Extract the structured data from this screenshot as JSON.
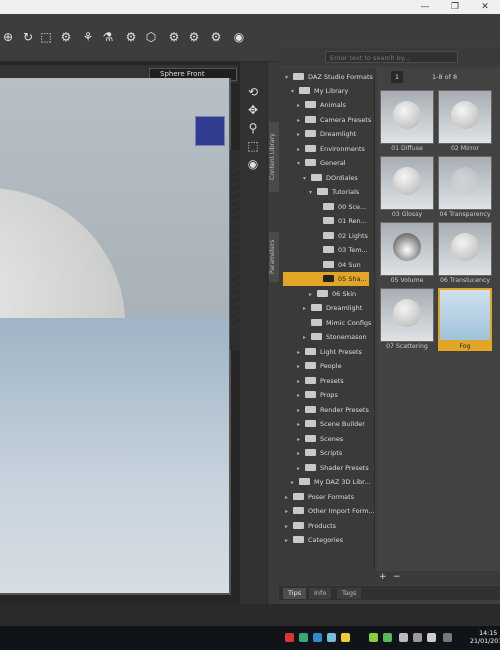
{
  "window": {
    "minimize_glyph": "—",
    "restore_glyph": "❐",
    "close_glyph": "✕"
  },
  "toolbar": {
    "icons": [
      "⊕",
      "↻",
      "⬚",
      "⚙",
      "⚘",
      "⚗",
      "⚙",
      "⬡",
      "⚙",
      "⚙",
      "⚙",
      "◉"
    ]
  },
  "viewport": {
    "camera": "Sphere Front"
  },
  "content_library": {
    "tab_label": "Content Library",
    "side_tabs": [
      "Content Library",
      "Parameters"
    ],
    "search_placeholder": "Enter text to search by...",
    "tree": [
      {
        "label": "DAZ Studio Formats",
        "level": 0
      },
      {
        "label": "My Library",
        "level": 1
      },
      {
        "label": "Animals",
        "level": 2
      },
      {
        "label": "Camera Presets",
        "level": 2
      },
      {
        "label": "Dreamlight",
        "level": 2
      },
      {
        "label": "Environments",
        "level": 2
      },
      {
        "label": "General",
        "level": 2
      },
      {
        "label": "DOrdiales",
        "level": 3
      },
      {
        "label": "Tutorials",
        "level": 4
      },
      {
        "label": "00 Sce...",
        "level": 5
      },
      {
        "label": "01 Ren...",
        "level": 5
      },
      {
        "label": "02 Lights",
        "level": 5
      },
      {
        "label": "03 Tem...",
        "level": 5
      },
      {
        "label": "04 Sun",
        "level": 5
      },
      {
        "label": "05 Sha...",
        "level": 5
      },
      {
        "label": "06 Skin",
        "level": 5
      },
      {
        "label": "Dreamlight",
        "level": 3
      },
      {
        "label": "Mimic Configs",
        "level": 3
      },
      {
        "label": "Stonemason",
        "level": 3
      },
      {
        "label": "Light Presets",
        "level": 2
      },
      {
        "label": "People",
        "level": 2
      },
      {
        "label": "Presets",
        "level": 2
      },
      {
        "label": "Props",
        "level": 2
      },
      {
        "label": "Render Presets",
        "level": 2
      },
      {
        "label": "Scene Builder",
        "level": 2
      },
      {
        "label": "Scenes",
        "level": 2
      },
      {
        "label": "Scripts",
        "level": 2
      },
      {
        "label": "Shader Presets",
        "level": 2
      },
      {
        "label": "My DAZ 3D Libr...",
        "level": 1
      },
      {
        "label": "Poser Formats",
        "level": 0
      },
      {
        "label": "Other Import Form...",
        "level": 0
      },
      {
        "label": "Products",
        "level": 0
      },
      {
        "label": "Categories",
        "level": 0
      }
    ],
    "page": "1",
    "page_range": "1-8 of 8",
    "items": [
      "01 Diffuse",
      "02 Mirror",
      "03 Glossy",
      "04 Transparency",
      "05 Volume",
      "06 Translucency",
      "07 Scattering",
      "Fog"
    ],
    "bottom_tabs": [
      "Tips",
      "Info",
      "Tags"
    ],
    "add_glyph": "+",
    "remove_glyph": "−"
  },
  "taskbar": {
    "time": "14:15",
    "date": "21/01/2016"
  }
}
